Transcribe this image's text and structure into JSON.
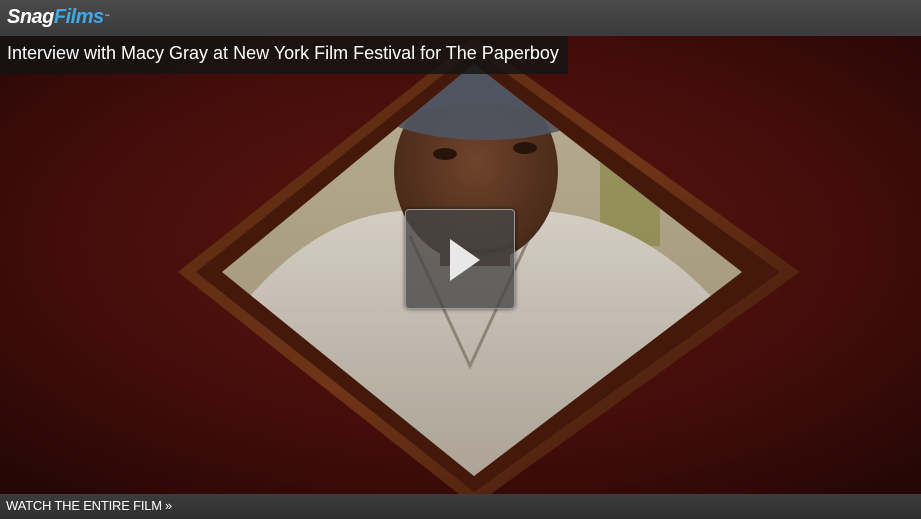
{
  "brand": {
    "logo_part1": "Snag",
    "logo_part2": "Films",
    "logo_tm": "™"
  },
  "video": {
    "title": "Interview with Macy Gray at New York Film Festival for The Paperboy",
    "play_icon": "play-icon"
  },
  "footer": {
    "watch_label": "WATCH THE ENTIRE FILM",
    "watch_arrow": "»"
  },
  "colors": {
    "brand_blue": "#3fa9e6",
    "bar_gray": "#3b3b3b",
    "backdrop_red": "#5a1410"
  }
}
